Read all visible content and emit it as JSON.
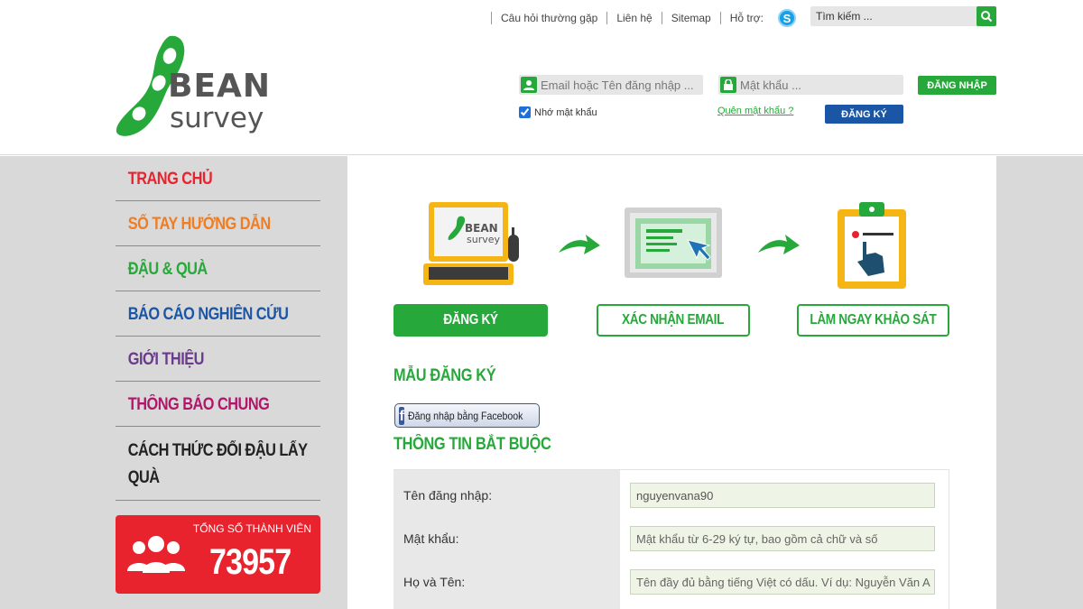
{
  "topnav": {
    "faq": "Câu hỏi thường gặp",
    "contact": "Liên hệ",
    "sitemap": "Sitemap",
    "support": "Hỗ trợ:",
    "search_placeholder": "Tìm kiếm ..."
  },
  "logo": {
    "line1": "BEAN",
    "line2": "survey"
  },
  "login": {
    "email_placeholder": "Email hoặc Tên đăng nhập ...",
    "password_placeholder": "Mật khẩu ...",
    "login_label": "ĐĂNG NHẬP",
    "remember_label": "Nhớ mật khẩu",
    "remember_checked": true,
    "forgot_label": "Quên mật khẩu ?",
    "register_label": "ĐĂNG KÝ"
  },
  "sidebar": {
    "items": [
      {
        "label": "TRANG CHỦ",
        "color": "#e8232e"
      },
      {
        "label": "SỔ TAY HƯỚNG DẪN",
        "color": "#f07d22"
      },
      {
        "label": "ĐẬU & QUÀ",
        "color": "#27a83a"
      },
      {
        "label": "BÁO CÁO NGHIÊN CỨU",
        "color": "#1b56a6"
      },
      {
        "label": "GIỚI THIỆU",
        "color": "#6b3a8e"
      },
      {
        "label": "THÔNG BÁO CHUNG",
        "color": "#b0176a"
      },
      {
        "label": "CÁCH THỨC ĐỔI ĐẬU LẤY QUÀ",
        "color": "#222222"
      }
    ],
    "member_label": "TỔNG SỐ THÀNH VIÊN",
    "member_count": "73957"
  },
  "steps": {
    "step1": "ĐĂNG KÝ",
    "step2": "XÁC NHẬN EMAIL",
    "step3": "LÀM NGAY KHẢO SÁT",
    "monitor_logo_line1": "BEAN",
    "monitor_logo_line2": "survey"
  },
  "form": {
    "title": "MẪU ĐĂNG KÝ",
    "facebook_label": "Đăng nhập bằng Facebook",
    "required_title": "THÔNG TIN BẮT BUỘC",
    "fields": [
      {
        "label": "Tên đăng nhập:",
        "value": "nguyenvana90",
        "placeholder": ""
      },
      {
        "label": "Mật khẩu:",
        "value": "",
        "placeholder": "Mật khẩu từ 6-29 ký tự, bao gồm cả chữ và số"
      },
      {
        "label": "Họ và Tên:",
        "value": "",
        "placeholder": "Tên đầy đủ bằng tiếng Việt có dấu. Ví dụ: Nguyễn Văn A"
      }
    ]
  },
  "colors": {
    "brand_green": "#27a83a",
    "brand_blue": "#1b56a6",
    "brand_red": "#e8232e",
    "sidebar_gray": "#d9d9d9"
  }
}
